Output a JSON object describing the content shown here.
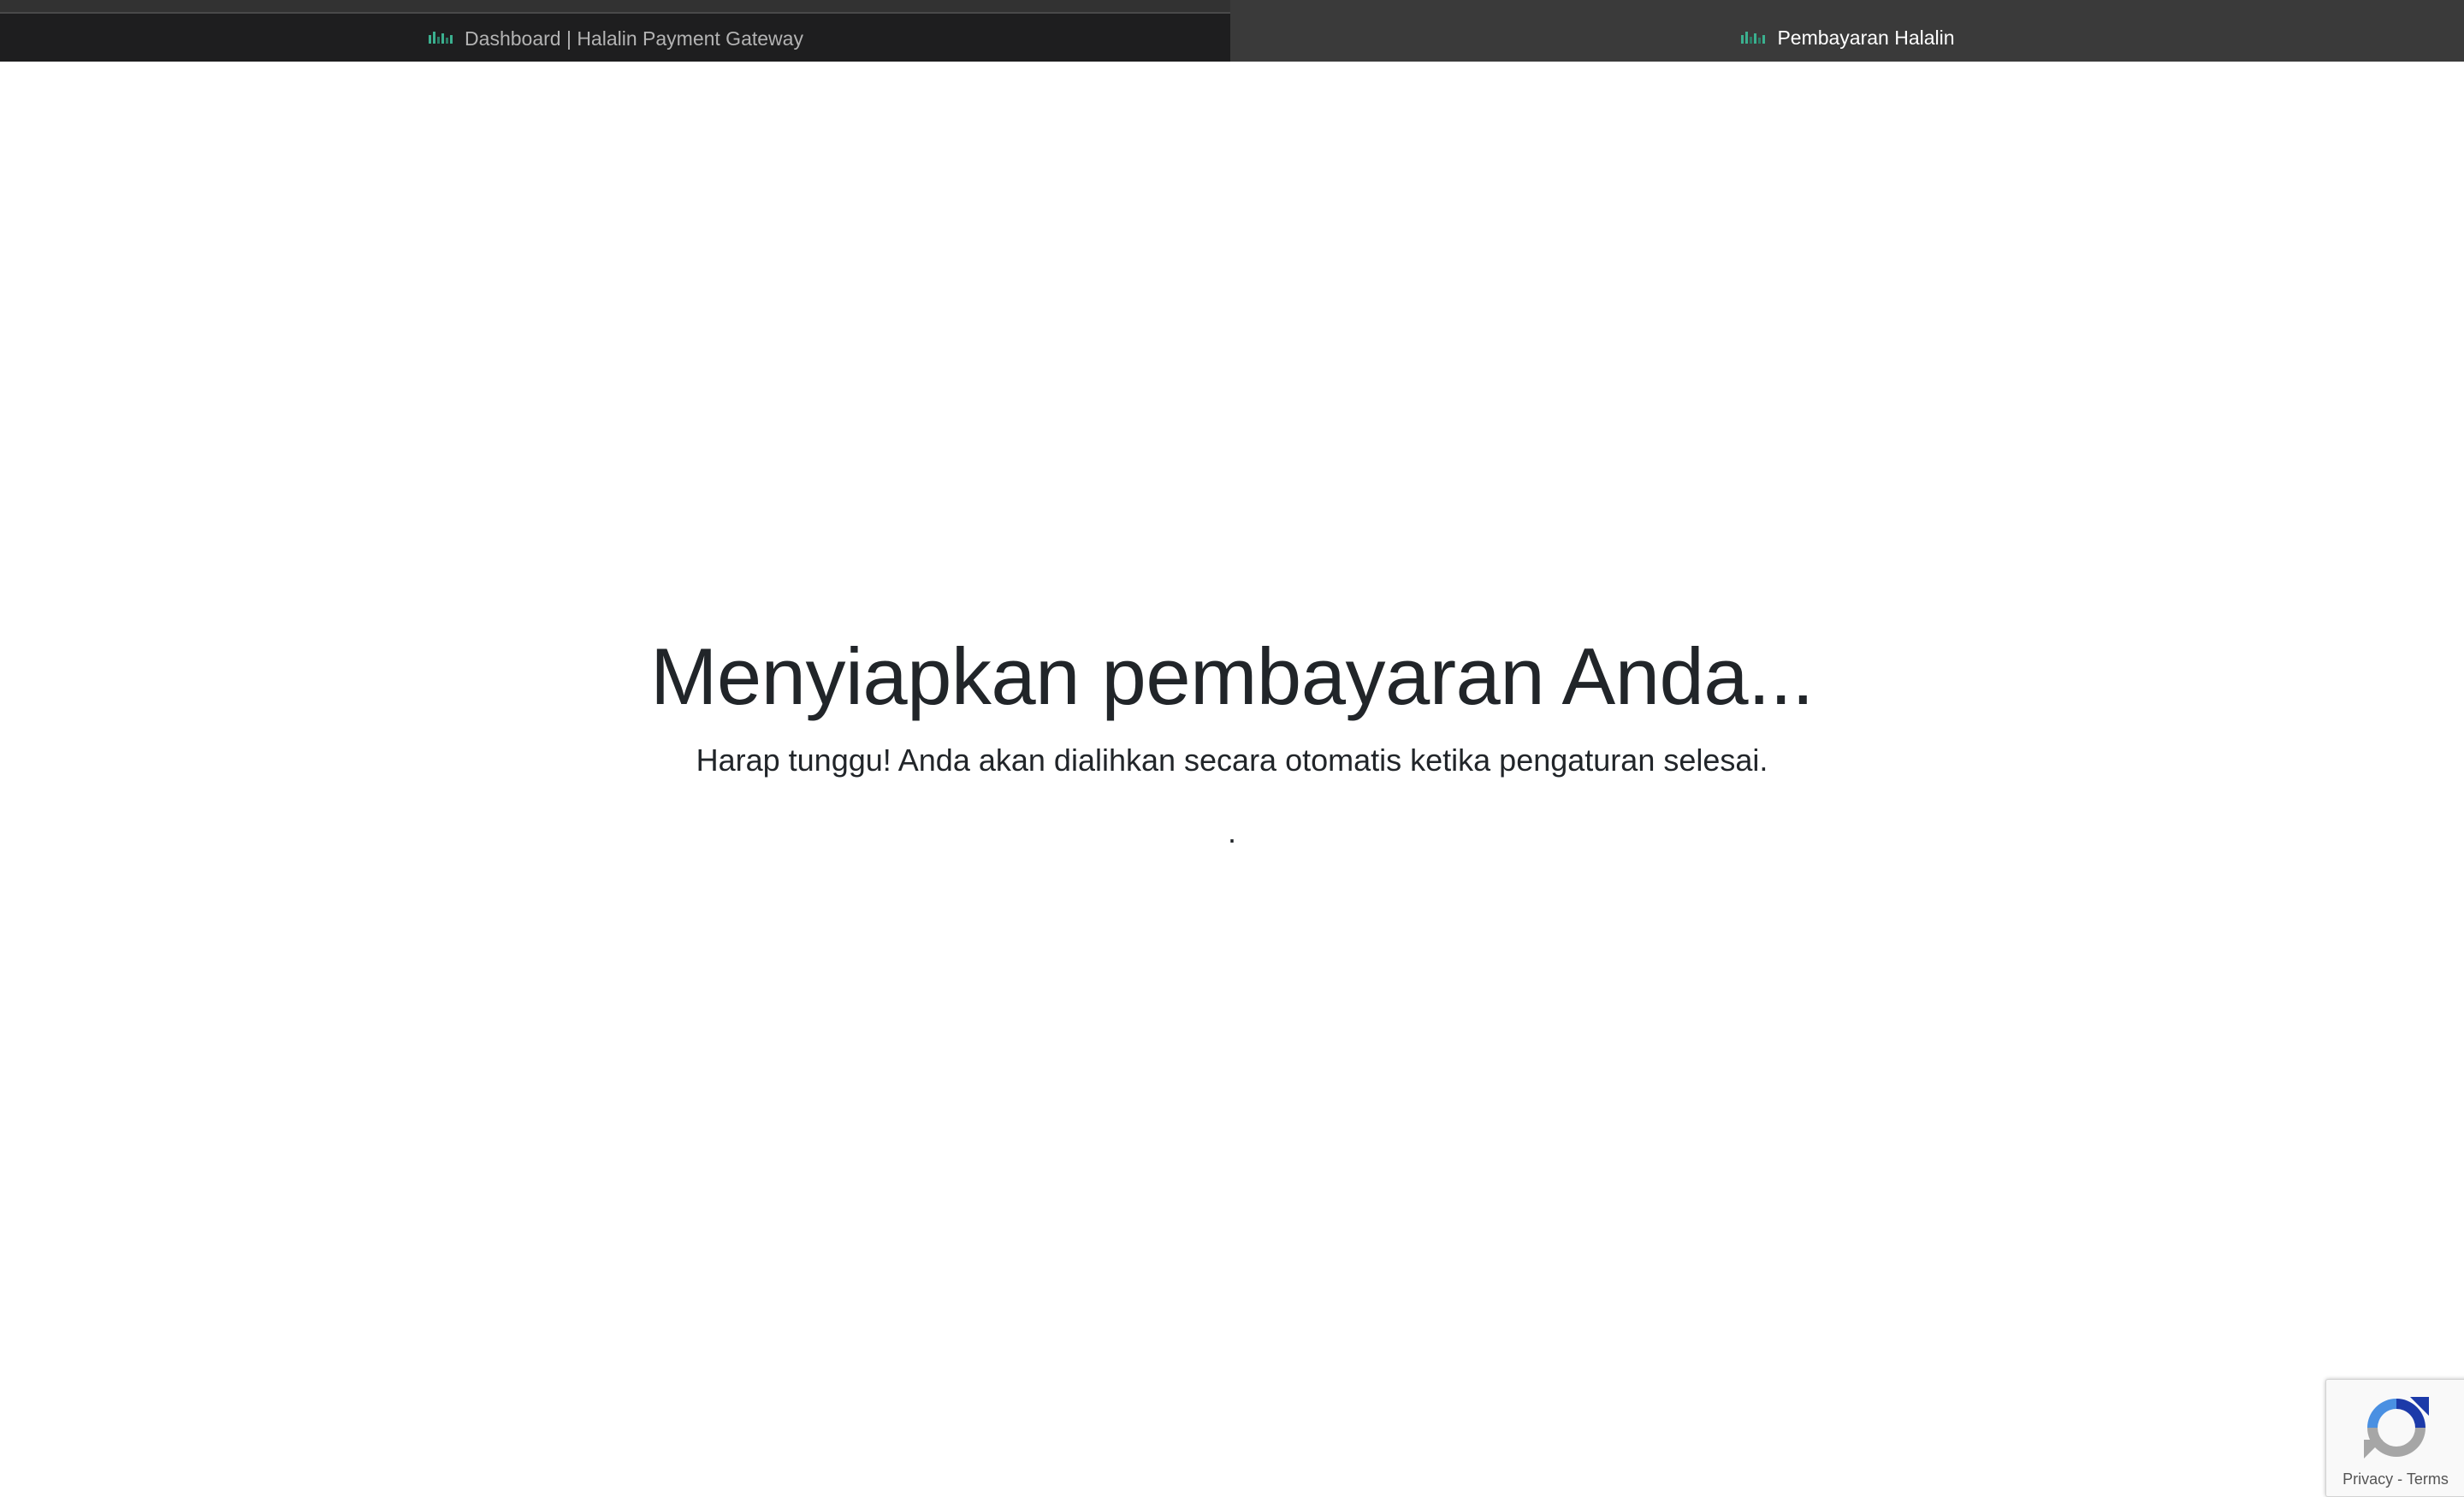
{
  "tabs": [
    {
      "title": "Dashboard | Halalin Payment Gateway",
      "icon": "halalin-favicon-icon",
      "active": false
    },
    {
      "title": "Pembayaran Halalin",
      "icon": "halalin-favicon-icon",
      "active": true
    }
  ],
  "main": {
    "title": "Menyiapkan pembayaran Anda...",
    "subtitle": "Harap tunggu! Anda akan dialihkan secara otomatis ketika pengaturan selesai.",
    "loading_indicator": "."
  },
  "recaptcha": {
    "icon": "recaptcha-icon",
    "privacy_label": "Privacy",
    "separator": "-",
    "terms_label": "Terms"
  },
  "colors": {
    "text": "#212529",
    "tab_active_bg": "#3a3a3a",
    "tab_inactive_bg": "#1e1e1f",
    "favicon_green": "#3bb08f",
    "recaptcha_blue": "#1c3aa9",
    "recaptcha_gray": "#a6a6a6"
  }
}
